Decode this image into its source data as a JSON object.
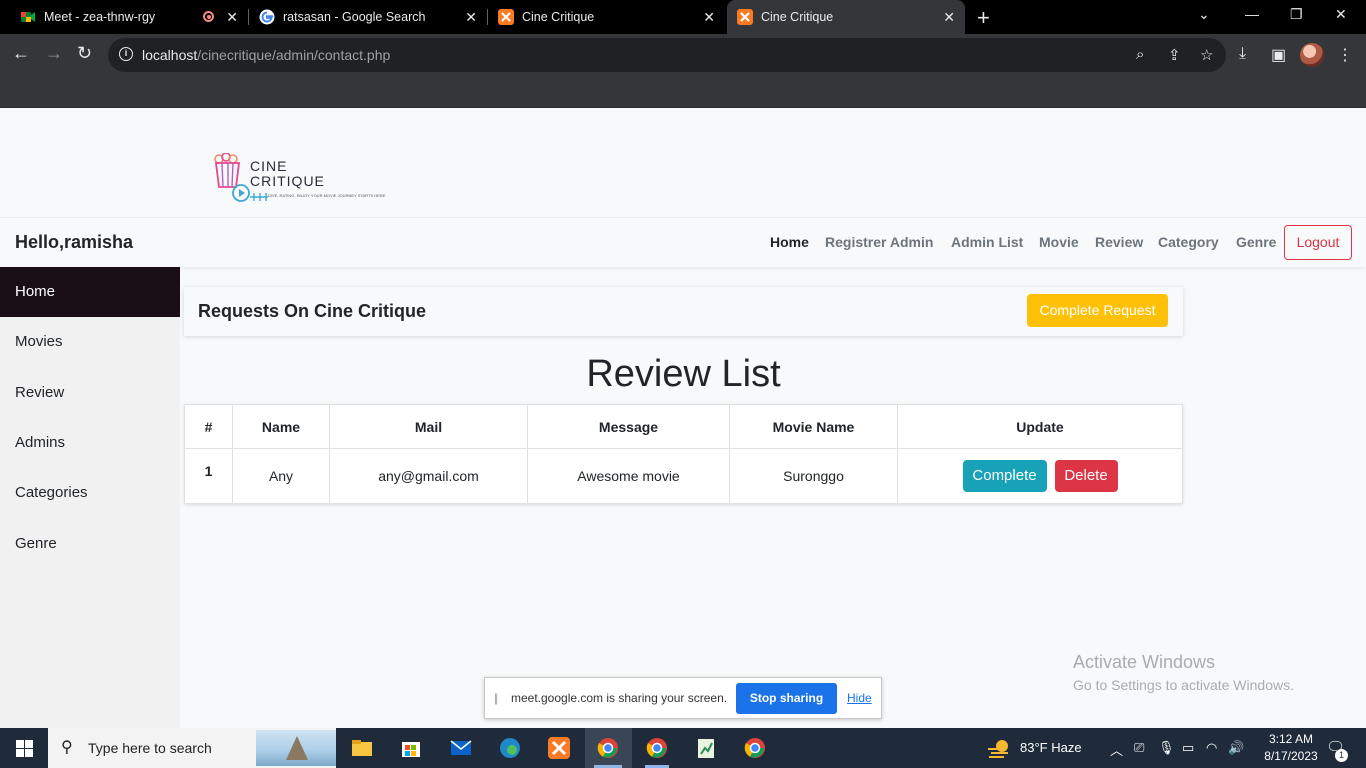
{
  "browser": {
    "tabs": [
      {
        "title": "Meet - zea-thnw-rgy",
        "icon": "google-meet-icon"
      },
      {
        "title": "ratsasan - Google Search",
        "icon": "google-icon"
      },
      {
        "title": "Cine Critique",
        "icon": "xampp-icon"
      },
      {
        "title": "Cine Critique",
        "icon": "xampp-icon",
        "active": true
      }
    ],
    "url_host": "localhost",
    "url_path": "/cinecritique/admin/contact.php"
  },
  "logo": {
    "line1": "CINE",
    "line2": "CRITIQUE",
    "tagline": "DIVE, RATING, ENJOY YOUR MOVIE JOURNEY STARTS HERE",
    "colors": {
      "popcorn": "#e8468f",
      "reel": "#3fa7d6"
    }
  },
  "navbar": {
    "greeting": "Hello,ramisha",
    "links": [
      "Home",
      "Registrer Admin",
      "Admin List",
      "Movie",
      "Review",
      "Category",
      "Genre"
    ],
    "logout": "Logout"
  },
  "sidebar": {
    "items": [
      "Home",
      "Movies",
      "Review",
      "Admins",
      "Categories",
      "Genre"
    ]
  },
  "requests": {
    "title": "Requests On Cine Critique",
    "button": "Complete Request"
  },
  "review_list": {
    "heading": "Review List",
    "columns": [
      "#",
      "Name",
      "Mail",
      "Message",
      "Movie Name",
      "Update"
    ],
    "rows": [
      {
        "num": "1",
        "name": "Any",
        "mail": "any@gmail.com",
        "message": "Awesome movie",
        "movie": "Suronggo",
        "complete": "Complete",
        "delete": "Delete"
      }
    ]
  },
  "watermark": {
    "line1": "Activate Windows",
    "line2": "Go to Settings to activate Windows."
  },
  "share_bar": {
    "text": "meet.google.com is sharing your screen.",
    "stop": "Stop sharing",
    "hide": "Hide"
  },
  "taskbar": {
    "search_placeholder": "Type here to search",
    "weather": "83°F  Haze",
    "time": "3:12 AM",
    "date": "8/17/2023",
    "notifications": "1"
  },
  "colors": {
    "warning": "#ffc107",
    "info": "#17a2b8",
    "danger": "#dc3545",
    "sidebar_active": "#1a0f17"
  }
}
